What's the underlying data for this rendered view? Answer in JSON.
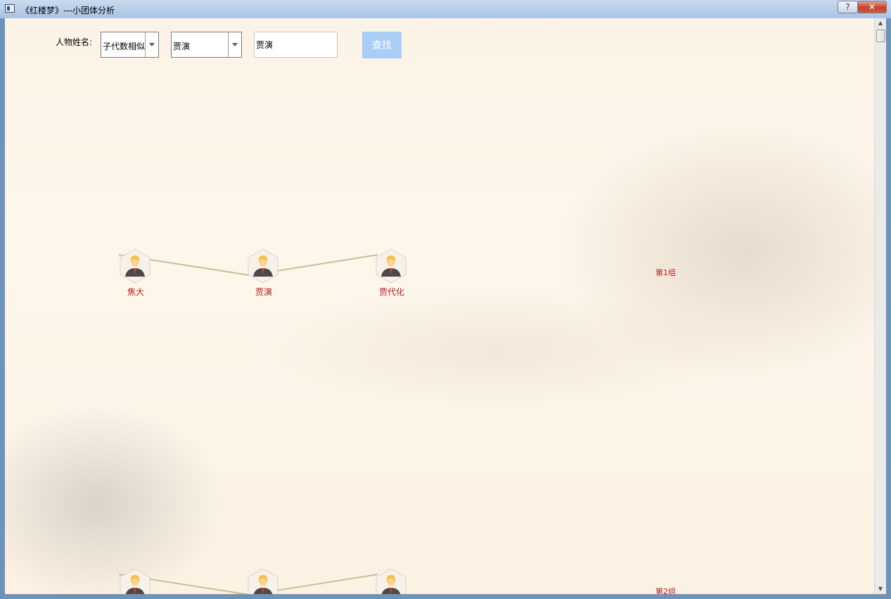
{
  "window": {
    "title": "《红楼梦》---小团体分析",
    "help_label": "?",
    "close_label": "✕"
  },
  "form": {
    "name_label": "人物姓名:",
    "type_select": {
      "value": "子代数相似"
    },
    "person_select": {
      "value": "贾演"
    },
    "name_input": {
      "value": "贾演"
    },
    "search_label": "查找"
  },
  "groups": [
    {
      "label": "第1组",
      "nodes": [
        {
          "name": "焦大"
        },
        {
          "name": "贾演"
        },
        {
          "name": "贾代化"
        }
      ]
    },
    {
      "label": "第2组",
      "nodes": [
        {
          "name": ""
        },
        {
          "name": ""
        },
        {
          "name": ""
        }
      ]
    }
  ],
  "colors": {
    "node_label": "#b81d1d",
    "edge": "#c8bf95",
    "search_button": "#a9cdf5"
  },
  "icons": {
    "app": "window-app-icon",
    "node": "person-avatar-icon",
    "dropdown": "chevron-down-icon"
  }
}
